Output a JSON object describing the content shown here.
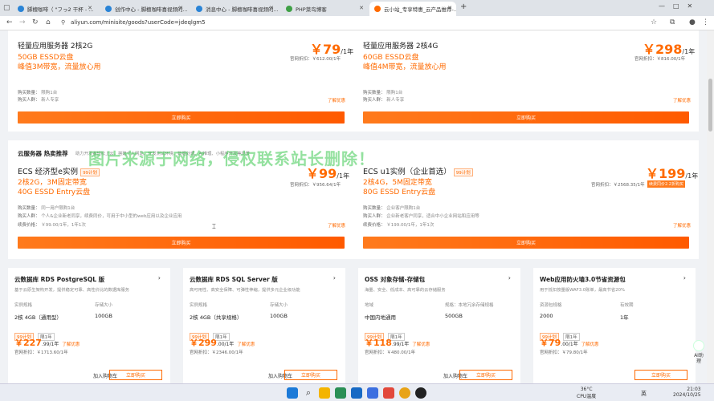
{
  "browser": {
    "tabs": [
      {
        "label": "脚檀咖啡（ \"フっ2 干杯 - ...",
        "color": "#2a84d6"
      },
      {
        "label": "创作中心 - 脚檀咖啡喜视频的...",
        "color": "#2a84d6"
      },
      {
        "label": "消息中心 - 脚檀咖啡喜视频的...",
        "color": "#2a84d6"
      },
      {
        "label": "PHP菜鸟博客",
        "color": "#3fa046"
      },
      {
        "label": "云小站_专享特惠_云产品推荐-...",
        "color": "#ff6a00"
      }
    ],
    "url": "aliyun.com/minisite/goods?userCode=jdeqlgm5",
    "new_tab": "+"
  },
  "top_cards": [
    {
      "line1": "轻量应用服务器 2核2G",
      "disk": "50GB ESSD云盘",
      "bw": "峰值3M带宽，流量放心用",
      "price": "79",
      "unit": "/1年",
      "orig": "官网折扣：￥612.00/1年",
      "limit_label": "购买数量：",
      "limit": "限购1台",
      "who_label": "购买人群：",
      "who": "新人专享",
      "detail": "了解优惠",
      "buy": "立即购买"
    },
    {
      "line1": "轻量应用服务器 2核4G",
      "disk": "60GB ESSD云盘",
      "bw": "峰值4M带宽，流量放心用",
      "price": "298",
      "unit": "/1年",
      "orig": "官网折扣：￥816.00/1年",
      "limit_label": "购买数量：",
      "limit": "限购1台",
      "who_label": "购买人群：",
      "who": "新人专享",
      "detail": "了解优惠",
      "buy": "立即购买"
    }
  ],
  "hot": {
    "title": "云服务器 热卖推荐",
    "subtitle": "助力开发者轻松上云，搭建个人网站、开发测试环境、数据处理、AI推理、小程序开发等场景",
    "watermark": "图片来源于网络，侵权联系站长删除！",
    "cards": [
      {
        "name": "ECS 经济型e实例",
        "tag": "99计划",
        "cfg": "2核2G，3M固定带宽",
        "disk": "40G ESSD Entry云盘",
        "price": "99",
        "unit": "/1年",
        "orig": "官网折扣：￥956.64/1年",
        "r1_label": "购买数量：",
        "r1": "同一用户限购1台",
        "r2_label": "购买人群：",
        "r2": "个人&企业新老同享，续费同价，可用于中小型的web应用以及企业应用",
        "r3_label": "续费价格：",
        "r3": "￥99.00/1年，1年1次",
        "detail": "了解优惠",
        "buy": "立即购买",
        "badge": ""
      },
      {
        "name": "ECS u1实例（企业首选）",
        "tag": "99计划",
        "cfg": "2核4G，5M固定带宽",
        "disk": "80G ESSD Entry云盘",
        "price": "199",
        "unit": "/1年",
        "orig": "官网折扣：￥2568.35/1年",
        "r1_label": "购买数量：",
        "r1": "企业客户限购1台",
        "r2_label": "购买人群：",
        "r2": "企业新老客户同享，适合中小企业网站和应用等",
        "r3_label": "续费价格：",
        "r3": "￥199.00/1年，1年1次",
        "detail": "了解优惠",
        "buy": "立即购买",
        "badge": "续费同价2.2折购买"
      }
    ]
  },
  "products": [
    {
      "title": "云数据库 RDS PostgreSQL 版",
      "desc": "基于云原生架构开发，提供稳定可靠、高性价比的数据库服务",
      "h1": "实例规格",
      "h2": "存储大小",
      "v1": "2核 4GB（通用型）",
      "v2": "100GB",
      "tag": "99计划",
      "limit": "限1年",
      "price": "227",
      "unit": ".99/1年",
      "detail": "了解优惠",
      "orig": "官网折扣：￥1713.60/1年",
      "cart": "加入购物车",
      "buy": "立即购买"
    },
    {
      "title": "云数据库 RDS SQL Server 版",
      "desc": "高可用性、高安全保障、可弹性伸缩，提供多元企业级功能",
      "h1": "实例规格",
      "h2": "存储大小",
      "v1": "2核 4GB（共享规格）",
      "v2": "100GB",
      "tag": "99计划",
      "limit": "限1年",
      "price": "299",
      "unit": ".00/1年",
      "detail": "了解优惠",
      "orig": "官网折扣：￥2346.00/1年",
      "cart": "加入购物车",
      "buy": "立即购买"
    },
    {
      "title": "OSS 对象存储-存储包",
      "desc": "海量、安全、低成本、高可靠的云存储服务",
      "h1": "地域",
      "h2": "规格：本地冗余存储规格",
      "v1": "中国内地通用",
      "v2": "500GB",
      "tag": "99计划",
      "limit": "限1年",
      "price": "118",
      "unit": ".99/1年",
      "detail": "了解优惠",
      "orig": "官网折扣：￥480.00/1年",
      "cart": "加入购物车",
      "buy": "立即购买"
    },
    {
      "title": "Web应用防火墙3.0节省资源包",
      "desc": "用于抵扣按量版WAF3.0账单，最高节省20%",
      "h1": "资源包规格",
      "h2": "有效期",
      "v1": "2000",
      "v2": "1年",
      "tag": "99计划",
      "limit": "限1年",
      "price": "79",
      "unit": ".00/1年",
      "detail": "了解优惠",
      "orig": "官网折扣：￥79.80/1年",
      "cart": "",
      "buy": "立即购买"
    }
  ],
  "side_ai": "AI助理",
  "taskbar": {
    "lang": "英",
    "temp": "36°C",
    "temp_label": "CPU温度",
    "time": "21:03",
    "date": "2024/10/25"
  }
}
